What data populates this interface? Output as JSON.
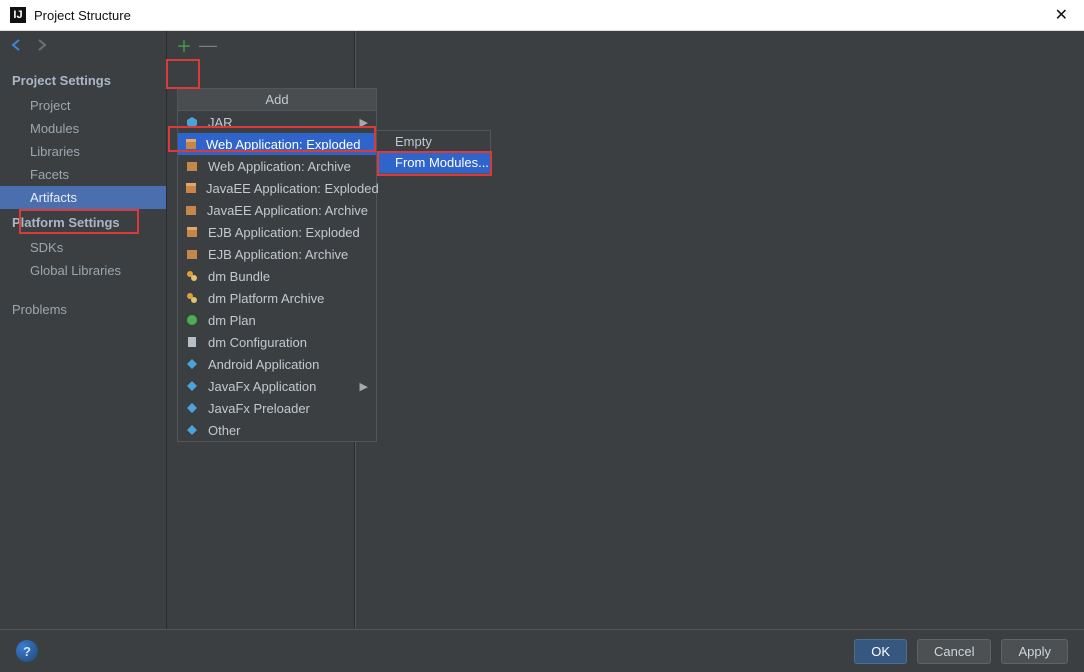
{
  "window": {
    "title": "Project Structure",
    "icon_letter": "IJ",
    "close_glyph": "✕"
  },
  "sidebar": {
    "section1": "Project Settings",
    "section2": "Platform Settings",
    "items1": [
      "Project",
      "Modules",
      "Libraries",
      "Facets",
      "Artifacts"
    ],
    "items2": [
      "SDKs",
      "Global Libraries"
    ],
    "problems": "Problems"
  },
  "add_menu": {
    "header": "Add",
    "items": [
      "JAR",
      "Web Application: Exploded",
      "Web Application: Archive",
      "JavaEE Application: Exploded",
      "JavaEE Application: Archive",
      "EJB Application: Exploded",
      "EJB Application: Archive",
      "dm Bundle",
      "dm Platform Archive",
      "dm Plan",
      "dm Configuration",
      "Android Application",
      "JavaFx Application",
      "JavaFx Preloader",
      "Other"
    ],
    "arrow_glyph": "▶"
  },
  "submenu": {
    "empty": "Empty",
    "from_modules": "From Modules..."
  },
  "buttons": {
    "ok": "OK",
    "cancel": "Cancel",
    "apply": "Apply",
    "help": "?"
  },
  "toolbar": {
    "plus": "＋",
    "minus": "—"
  }
}
